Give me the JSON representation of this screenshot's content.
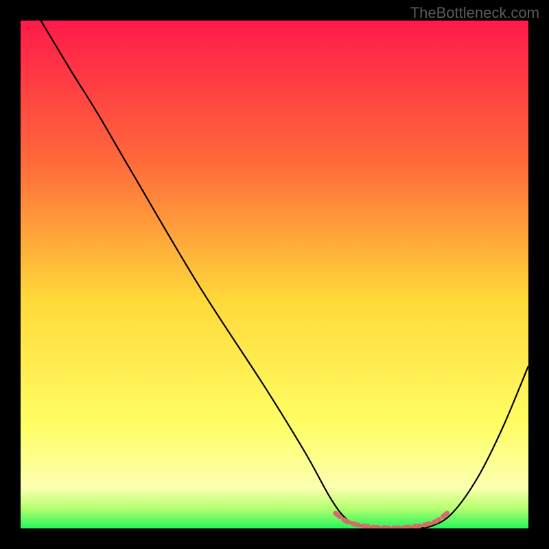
{
  "watermark": "TheBottleneck.com",
  "chart_data": {
    "type": "line",
    "title": "",
    "xlabel": "",
    "ylabel": "",
    "xlim": [
      0,
      100
    ],
    "ylim": [
      0,
      100
    ],
    "gradient_stops": [
      {
        "offset": 0,
        "color": "#ff1a4a"
      },
      {
        "offset": 28,
        "color": "#ff6a3a"
      },
      {
        "offset": 55,
        "color": "#ffd93a"
      },
      {
        "offset": 80,
        "color": "#ffff66"
      },
      {
        "offset": 92,
        "color": "#fcffb0"
      },
      {
        "offset": 96,
        "color": "#b6ff70"
      },
      {
        "offset": 100,
        "color": "#28f55a"
      }
    ],
    "series": [
      {
        "name": "curve",
        "stroke": "#000000",
        "points": [
          {
            "x": 4,
            "y": 100
          },
          {
            "x": 10,
            "y": 90
          },
          {
            "x": 15,
            "y": 82
          },
          {
            "x": 22,
            "y": 70
          },
          {
            "x": 35,
            "y": 48
          },
          {
            "x": 48,
            "y": 28
          },
          {
            "x": 56,
            "y": 15
          },
          {
            "x": 61,
            "y": 6
          },
          {
            "x": 64,
            "y": 2
          },
          {
            "x": 67,
            "y": 0.5
          },
          {
            "x": 72,
            "y": 0
          },
          {
            "x": 77,
            "y": 0
          },
          {
            "x": 81,
            "y": 0.5
          },
          {
            "x": 85,
            "y": 3
          },
          {
            "x": 90,
            "y": 10
          },
          {
            "x": 95,
            "y": 20
          },
          {
            "x": 100,
            "y": 32
          }
        ]
      },
      {
        "name": "bottom-marker",
        "stroke": "#d96a6a",
        "points": [
          {
            "x": 62,
            "y": 3
          },
          {
            "x": 64,
            "y": 1.5
          },
          {
            "x": 66,
            "y": 0.8
          },
          {
            "x": 68,
            "y": 0.4
          },
          {
            "x": 70,
            "y": 0.2
          },
          {
            "x": 72,
            "y": 0.1
          },
          {
            "x": 74,
            "y": 0.1
          },
          {
            "x": 76,
            "y": 0.2
          },
          {
            "x": 78,
            "y": 0.4
          },
          {
            "x": 80,
            "y": 0.8
          },
          {
            "x": 82,
            "y": 1.5
          },
          {
            "x": 84,
            "y": 3
          }
        ]
      }
    ]
  }
}
